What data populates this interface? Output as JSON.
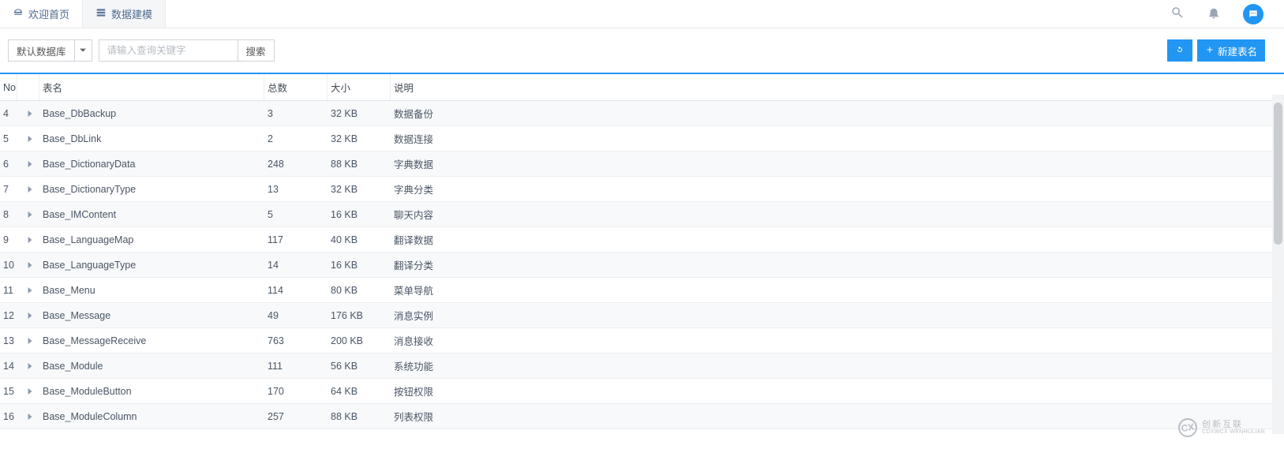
{
  "tabs": [
    {
      "label": "欢迎首页",
      "icon": "dashboard-icon"
    },
    {
      "label": "数据建模",
      "icon": "table-icon"
    }
  ],
  "header_icons": {
    "search": "search-icon",
    "bell": "bell-icon",
    "chat": "chat-icon"
  },
  "toolbar": {
    "db_label": "默认数据库",
    "search_placeholder": "请输入查询关键字",
    "search_btn": "搜索",
    "refresh_btn": "",
    "new_btn": "新建表名"
  },
  "columns": {
    "no": "No",
    "expand": "",
    "name": "表名",
    "total": "总数",
    "size": "大小",
    "desc": "说明"
  },
  "rows": [
    {
      "no": "4",
      "name": "Base_DbBackup",
      "total": "3",
      "size": "32 KB",
      "desc": "数据备份"
    },
    {
      "no": "5",
      "name": "Base_DbLink",
      "total": "2",
      "size": "32 KB",
      "desc": "数据连接"
    },
    {
      "no": "6",
      "name": "Base_DictionaryData",
      "total": "248",
      "size": "88 KB",
      "desc": "字典数据"
    },
    {
      "no": "7",
      "name": "Base_DictionaryType",
      "total": "13",
      "size": "32 KB",
      "desc": "字典分类"
    },
    {
      "no": "8",
      "name": "Base_IMContent",
      "total": "5",
      "size": "16 KB",
      "desc": "聊天内容"
    },
    {
      "no": "9",
      "name": "Base_LanguageMap",
      "total": "117",
      "size": "40 KB",
      "desc": "翻译数据"
    },
    {
      "no": "10",
      "name": "Base_LanguageType",
      "total": "14",
      "size": "16 KB",
      "desc": "翻译分类"
    },
    {
      "no": "11",
      "name": "Base_Menu",
      "total": "114",
      "size": "80 KB",
      "desc": "菜单导航"
    },
    {
      "no": "12",
      "name": "Base_Message",
      "total": "49",
      "size": "176 KB",
      "desc": "消息实例"
    },
    {
      "no": "13",
      "name": "Base_MessageReceive",
      "total": "763",
      "size": "200 KB",
      "desc": "消息接收"
    },
    {
      "no": "14",
      "name": "Base_Module",
      "total": "111",
      "size": "56 KB",
      "desc": "系统功能"
    },
    {
      "no": "15",
      "name": "Base_ModuleButton",
      "total": "170",
      "size": "64 KB",
      "desc": "按钮权限"
    },
    {
      "no": "16",
      "name": "Base_ModuleColumn",
      "total": "257",
      "size": "88 KB",
      "desc": "列表权限"
    }
  ],
  "watermark": {
    "top": "创新互联",
    "bottom": "CDXWCX WENHULIAN"
  }
}
